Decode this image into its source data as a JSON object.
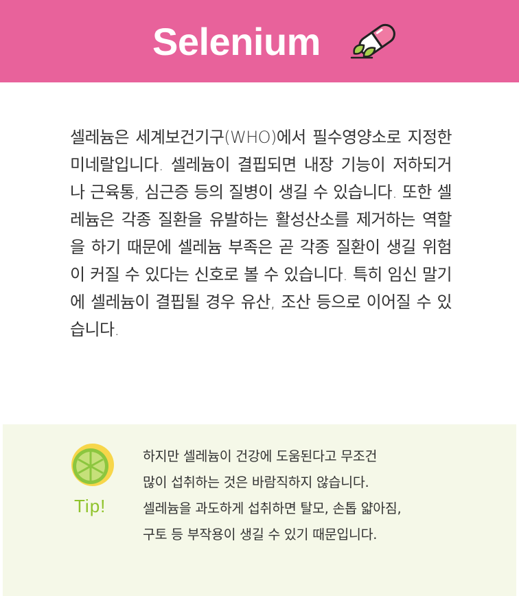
{
  "header": {
    "title": "Selenium",
    "icon": "pill-capsule-icon",
    "background": "#e8629b"
  },
  "body": {
    "paragraph": "셀레늄은 세계보건기구(WHO)에서 필수영양소로 지정한 미네랄입니다. 셀레늄이 결핍되면 내장 기능이 저하되거나 근육통, 심근증 등의 질병이 생길 수 있습니다. 또한 셀레늄은 각종 질환을 유발하는 활성산소를 제거하는 역할을 하기 때문에 셀레늄 부족은 곧 각종 질환이 생길 위험이 커질 수 있다는 신호로 볼 수 있습니다. 특히 임신 말기에 셀레늄이 결핍될 경우 유산, 조산 등으로 이어질 수 있습니다."
  },
  "tip": {
    "label": "Tip!",
    "icon": "lime-slice-icon",
    "lines": [
      "하지만 셀레늄이 건강에 도움된다고 무조건",
      "많이 섭취하는 것은 바람직하지 않습니다.",
      "셀레늄을 과도하게 섭취하면 탈모, 손톱 얇아짐,",
      "구토 등 부작용이 생길 수 있기 때문입니다."
    ],
    "background": "#f5f8e8",
    "label_color": "#8fc32b"
  }
}
